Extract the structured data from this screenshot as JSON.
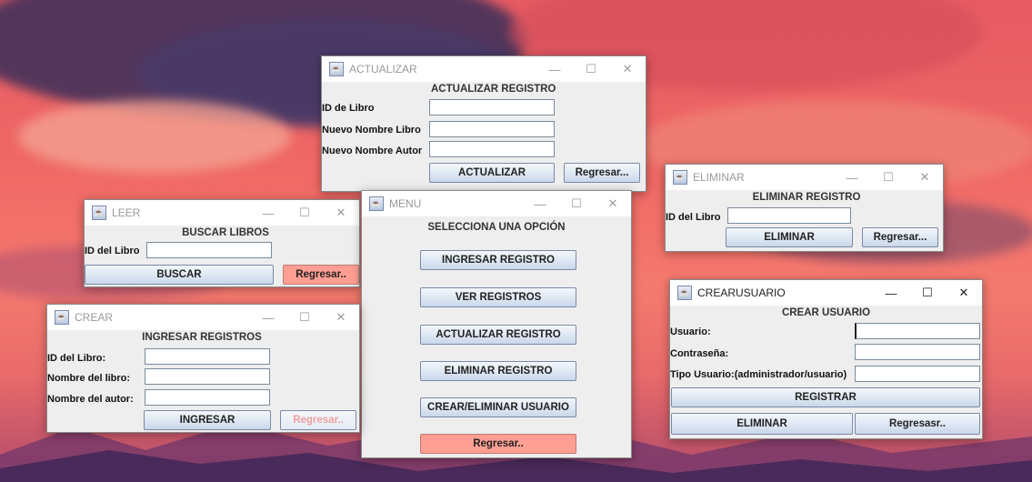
{
  "windows": {
    "actualizar": {
      "title": "ACTUALIZAR",
      "header": "ACTUALIZAR REGISTRO",
      "id_label": "ID de Libro",
      "nombre_label": "Nuevo Nombre  Libro",
      "autor_label": "Nuevo Nombre Autor",
      "submit": "ACTUALIZAR",
      "back": "Regresar..."
    },
    "eliminar": {
      "title": "ELIMINAR",
      "header": "ELIMINAR REGISTRO",
      "id_label": "ID del Libro",
      "submit": "ELIMINAR",
      "back": "Regresar..."
    },
    "leer": {
      "title": "LEER",
      "header": "BUSCAR LIBROS",
      "id_label": "ID del Libro",
      "submit": "BUSCAR",
      "back": "Regresar.."
    },
    "menu": {
      "title": "MENU",
      "header": "SELECCIONA UNA OPCIÓN",
      "btn_ingresar": "INGRESAR REGISTRO",
      "btn_ver": "VER REGISTROS",
      "btn_actualizar": "ACTUALIZAR REGISTRO",
      "btn_eliminar": "ELIMINAR REGISTRO",
      "btn_usuario": "CREAR/ELIMINAR USUARIO",
      "btn_regresar": "Regresar.."
    },
    "crear": {
      "title": "CREAR",
      "header": "INGRESAR REGISTROS",
      "id_label": "ID del Libro:",
      "nombre_label": "Nombre del libro:",
      "autor_label": "Nombre del autor:",
      "submit": "INGRESAR",
      "back": "Regresar.."
    },
    "crearusuario": {
      "title": "CREARUSUARIO",
      "header": "CREAR USUARIO",
      "usuario_label": "Usuario:",
      "contrasena_label": "Contraseña:",
      "tipo_label": "Tipo Usuario:(administrador/usuario)",
      "submit": "REGISTRAR",
      "delete": "ELIMINAR",
      "back": "Regresasr.."
    }
  },
  "controls": {
    "minimize": "—",
    "maximize": "☐",
    "close": "✕"
  },
  "colors": {
    "desktop_top": "#e65a62",
    "button_red": "#ff9e93"
  }
}
